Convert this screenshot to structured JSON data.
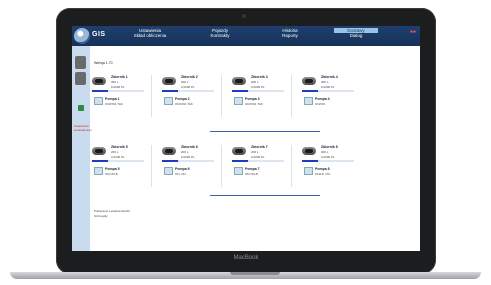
{
  "app": {
    "logo_text": "GIS"
  },
  "menu": [
    {
      "line1": "Ustawienia",
      "line2": "Skład obliczenia"
    },
    {
      "line1": "Pojazdy",
      "line2": "Kontrakty"
    },
    {
      "line1": "Historia",
      "line2": "Raporty"
    },
    {
      "line1": "Dostawy",
      "line2": "Dialog"
    }
  ],
  "sidebar": {
    "red_text": "Ustawienia powiadomień"
  },
  "page": {
    "version_label": "Wersja 1.70"
  },
  "tanks": [
    {
      "title": "Zbiornik 1",
      "line1": "300 L",
      "line2": "0,0000 PL",
      "fill": 0.3
    },
    {
      "title": "Zbiornik 2",
      "line1": "200 L",
      "line2": "0,0000 PL",
      "fill": 0.3
    },
    {
      "title": "Zbiornik 3",
      "line1": "200 L",
      "line2": "0,0000 PL",
      "fill": 0.3
    },
    {
      "title": "Zbiornik 4",
      "line1": "300 L",
      "line2": "0,0000 PL",
      "fill": 0.3
    },
    {
      "title": "Zbiornik 5",
      "line1": "200 L",
      "line2": "0,0000 PL",
      "fill": 0.3
    },
    {
      "title": "Zbiornik 6",
      "line1": "200 L",
      "line2": "0,0000 PL",
      "fill": 0.3
    },
    {
      "title": "Zbiornik 7",
      "line1": "200 L",
      "line2": "0,0000 PL",
      "fill": 0.3
    },
    {
      "title": "Zbiornik 8",
      "line1": "300 L",
      "line2": "0,0000 PL",
      "fill": 0.3
    }
  ],
  "pumps": [
    {
      "title": "Pompa 1",
      "sub": "ON/ON1 TAK"
    },
    {
      "title": "Pompa 2",
      "sub": "ON/ON1 TAK"
    },
    {
      "title": "Pompa 3",
      "sub": "ON/ON1 TAK"
    },
    {
      "title": "Pompa 4",
      "sub": "ON/ON"
    },
    {
      "title": "Pompa 5",
      "sub": "SM ON B"
    },
    {
      "title": "Pompa 6",
      "sub": "ON, ON"
    },
    {
      "title": "Pompa 7",
      "sub": "SM ON B"
    },
    {
      "title": "Pompa 8",
      "sub": "ON/LP, ON"
    }
  ],
  "footer": {
    "legend1": "Pobieranie   Lewarka   Zwolni",
    "legend2": "Szczegóły"
  },
  "device": {
    "brand": "MacBook"
  }
}
